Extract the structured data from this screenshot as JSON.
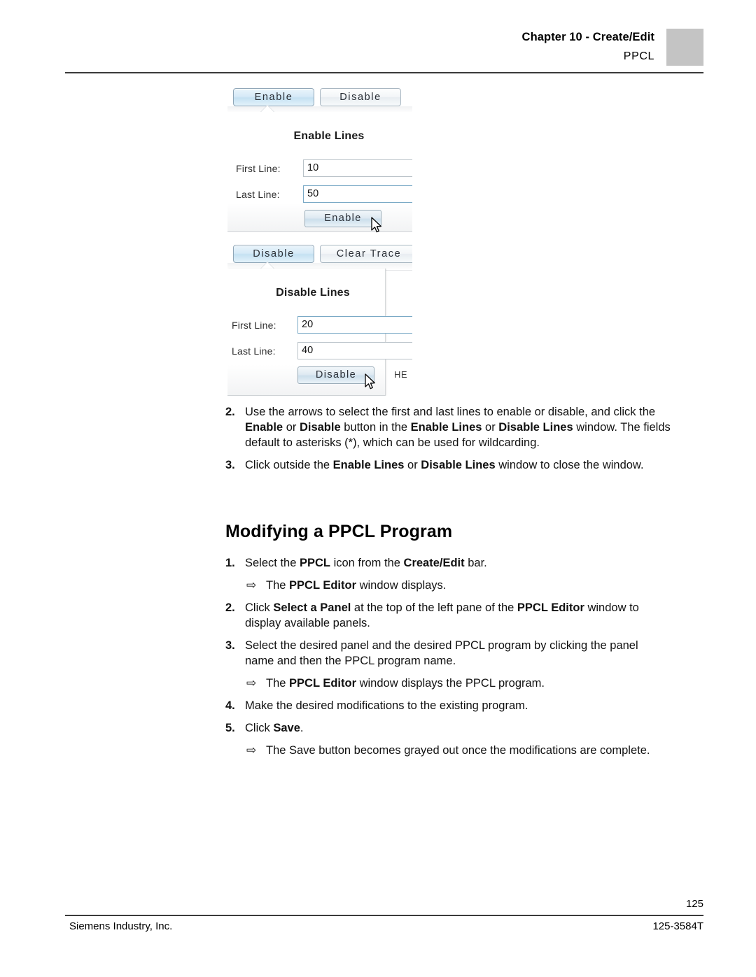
{
  "header": {
    "chapter": "Chapter 10 - Create/Edit",
    "section": "PPCL"
  },
  "screenshot": {
    "enable_panel": {
      "toolbar": {
        "enable_tab": "Enable",
        "disable_tab": "Disable"
      },
      "title": "Enable Lines",
      "first_line_label": "First Line:",
      "first_line_value": "10",
      "last_line_label": "Last Line:",
      "last_line_value": "50",
      "action_button": "Enable"
    },
    "disable_panel": {
      "toolbar": {
        "disable_tab": "Disable",
        "clear_trace_tab": "Clear Trace"
      },
      "title": "Disable Lines",
      "first_line_label": "First Line:",
      "first_line_value": "20",
      "last_line_label": "Last Line:",
      "last_line_value": "40",
      "action_button": "Disable",
      "clipped_text": "HE"
    }
  },
  "steps_top": [
    {
      "number": "2.",
      "lines": [
        [
          {
            "t": "Use the arrows to select the first and last lines to enable or disable, and click the",
            "b": false
          }
        ],
        [
          {
            "t": "Enable",
            "b": true
          },
          {
            "t": " or ",
            "b": false
          },
          {
            "t": "Disable",
            "b": true
          },
          {
            "t": " button in the ",
            "b": false
          },
          {
            "t": "Enable Lines",
            "b": true
          },
          {
            "t": " or ",
            "b": false
          },
          {
            "t": "Disable Lines",
            "b": true
          },
          {
            "t": " window. The fields",
            "b": false
          }
        ],
        [
          {
            "t": "default to asterisks (*), which can be used for wildcarding.",
            "b": false
          }
        ]
      ]
    },
    {
      "number": "3.",
      "lines": [
        [
          {
            "t": "Click outside the ",
            "b": false
          },
          {
            "t": "Enable Lines",
            "b": true
          },
          {
            "t": " or ",
            "b": false
          },
          {
            "t": "Disable Lines",
            "b": true
          },
          {
            "t": " window to close the window.",
            "b": false
          }
        ]
      ]
    }
  ],
  "section_heading": "Modifying a PPCL Program",
  "steps_main": [
    {
      "kind": "num",
      "number": "1.",
      "lines": [
        [
          {
            "t": "Select the ",
            "b": false
          },
          {
            "t": "PPCL",
            "b": true
          },
          {
            "t": " icon from the ",
            "b": false
          },
          {
            "t": "Create/Edit",
            "b": true
          },
          {
            "t": " bar.",
            "b": false
          }
        ]
      ]
    },
    {
      "kind": "arrow",
      "arrow": "⇨",
      "lines": [
        [
          {
            "t": "The ",
            "b": false
          },
          {
            "t": "PPCL Editor",
            "b": true
          },
          {
            "t": " window displays.",
            "b": false
          }
        ]
      ]
    },
    {
      "kind": "num",
      "number": "2.",
      "lines": [
        [
          {
            "t": "Click ",
            "b": false
          },
          {
            "t": "Select a Panel",
            "b": true
          },
          {
            "t": " at the top of the left pane of the ",
            "b": false
          },
          {
            "t": "PPCL Editor",
            "b": true
          },
          {
            "t": " window to",
            "b": false
          }
        ],
        [
          {
            "t": "display available panels.",
            "b": false
          }
        ]
      ]
    },
    {
      "kind": "num",
      "number": "3.",
      "lines": [
        [
          {
            "t": "Select the desired panel and the desired PPCL program by clicking the panel",
            "b": false
          }
        ],
        [
          {
            "t": "name and then the PPCL program name.",
            "b": false
          }
        ]
      ]
    },
    {
      "kind": "arrow",
      "arrow": "⇨",
      "lines": [
        [
          {
            "t": "The ",
            "b": false
          },
          {
            "t": "PPCL Editor",
            "b": true
          },
          {
            "t": " window displays the PPCL program.",
            "b": false
          }
        ]
      ]
    },
    {
      "kind": "num",
      "number": "4.",
      "lines": [
        [
          {
            "t": "Make the desired modifications to the existing program.",
            "b": false
          }
        ]
      ]
    },
    {
      "kind": "num",
      "number": "5.",
      "lines": [
        [
          {
            "t": "Click ",
            "b": false
          },
          {
            "t": "Save",
            "b": true
          },
          {
            "t": ".",
            "b": false
          }
        ]
      ]
    },
    {
      "kind": "arrow",
      "arrow": "⇨",
      "lines": [
        [
          {
            "t": "The Save button becomes grayed out once the modifications are complete.",
            "b": false
          }
        ]
      ]
    }
  ],
  "footer": {
    "page_number": "125",
    "company": "Siemens Industry, Inc.",
    "doc_number": "125-3584T"
  }
}
